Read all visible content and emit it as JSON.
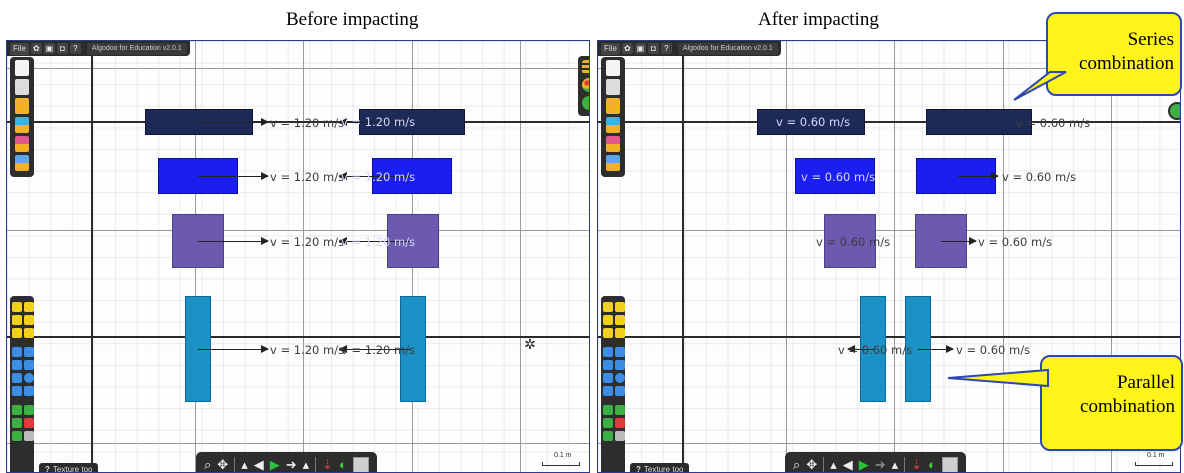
{
  "colors": {
    "frame_border": "#2b3a8c",
    "body_series_top": "#1d2a56",
    "body_series_middle": "#1a1ef0",
    "body_square": "#6c5ab0",
    "body_parallel": "#1c91c6",
    "callout_fill": "#fff41a",
    "callout_border": "#2d47b4"
  },
  "panels": [
    {
      "caption": "Before impacting",
      "menu": {
        "file": "File",
        "help": "?",
        "app_title": "Algodoo for Education v2.0.1"
      },
      "texture_tool": "Texture too",
      "scale_label": "0.1 m",
      "velocity_labels": [
        "v = 1.20 m/s",
        "v = 1.20 m/s",
        "v = 1.20 m/s",
        "v = 1.20 m/s",
        "v = 1.20 m/s",
        "v = 1.20 m/s",
        "v = 1.20 m/s",
        "v = 1.20 m/s"
      ]
    },
    {
      "caption": "After impacting",
      "menu": {
        "file": "File",
        "help": "?",
        "app_title": "Algodoo for Education v2.0.1"
      },
      "texture_tool": "Texture too",
      "scale_label": "0.1 m",
      "velocity_labels": [
        "v = 0.60 m/s",
        "v = 0.60 m/s",
        "v = 0.60 m/s",
        "v = 0.60 m/s",
        "v = 0.60 m/s",
        "v = 0.60 m/s",
        "v = 0.60 m/s",
        "v = 0.60 m/s"
      ]
    }
  ],
  "callouts": {
    "series": {
      "line1": "Series",
      "line2": "combination"
    },
    "parallel": {
      "line1": "Parallel",
      "line2": "combination"
    }
  },
  "icons": {
    "menu_gear": "gear-icon",
    "menu_save": "save-icon",
    "left_tools": [
      "new-scene-icon",
      "save-scene-icon",
      "open-folder-icon",
      "scene-folder-icon",
      "screenshot-icon",
      "notes-icon"
    ],
    "right_tools": [
      "menu-lines-icon",
      "palette-icon",
      "settings-icon"
    ],
    "bottom": [
      "zoom-icon",
      "pan-icon",
      "undo-icon",
      "play-icon",
      "redo-icon",
      "gravity-icon",
      "air-icon",
      "grid-icon"
    ]
  }
}
